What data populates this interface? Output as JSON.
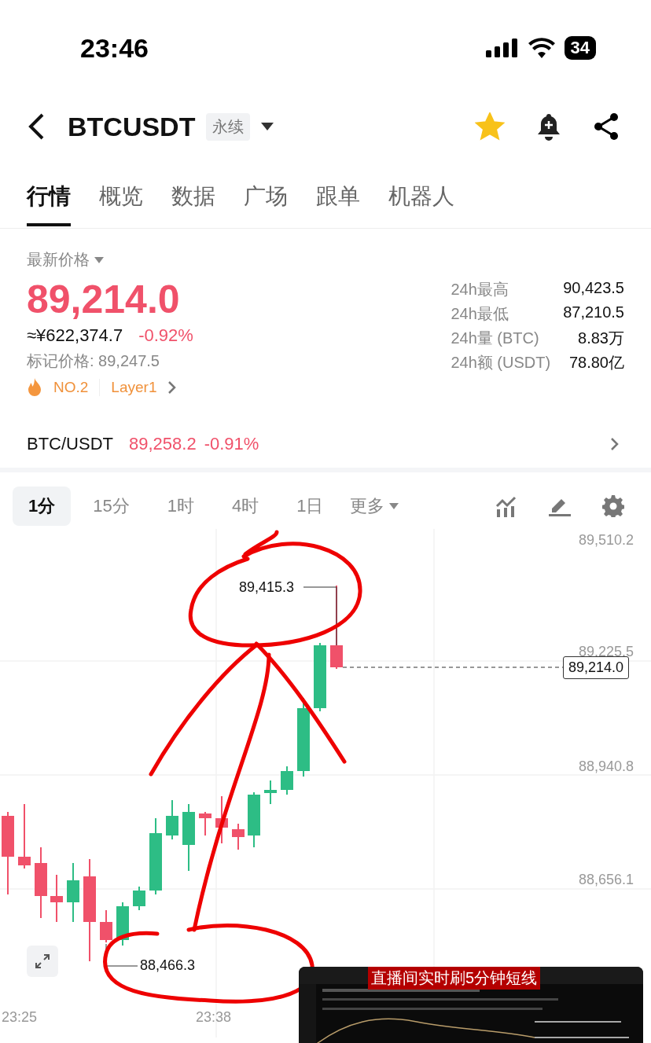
{
  "status_bar": {
    "time": "23:46",
    "battery": "34"
  },
  "header": {
    "symbol": "BTCUSDT",
    "badge": "永续",
    "favorited": true
  },
  "tabs": [
    {
      "label": "行情",
      "selected": true
    },
    {
      "label": "概览",
      "selected": false
    },
    {
      "label": "数据",
      "selected": false
    },
    {
      "label": "广场",
      "selected": false
    },
    {
      "label": "跟单",
      "selected": false
    },
    {
      "label": "机器人",
      "selected": false
    }
  ],
  "price": {
    "label": "最新价格",
    "last": "89,214.0",
    "cny": "≈¥622,374.7",
    "change": "-0.92%",
    "mark_price": "标记价格: 89,247.5",
    "rank": "NO.2",
    "sector": "Layer1"
  },
  "stats": [
    {
      "label": "24h最高",
      "value": "90,423.5"
    },
    {
      "label": "24h最低",
      "value": "87,210.5"
    },
    {
      "label": "24h量 (BTC)",
      "value": "8.83万"
    },
    {
      "label": "24h额 (USDT)",
      "value": "78.80亿"
    }
  ],
  "spot": {
    "pair": "BTC/USDT",
    "price": "89,258.2",
    "change": "-0.91%"
  },
  "timeframes": [
    {
      "label": "1分",
      "selected": true
    },
    {
      "label": "15分",
      "selected": false
    },
    {
      "label": "1时",
      "selected": false
    },
    {
      "label": "4时",
      "selected": false
    },
    {
      "label": "1日",
      "selected": false
    }
  ],
  "more": "更多",
  "chart": {
    "price_ticks": [
      "89,510.2",
      "89,225.5",
      "88,940.8",
      "88,656.1"
    ],
    "current_price": "89,214.0",
    "high_label": "89,415.3",
    "low_label": "88,466.3",
    "time_labels": [
      "23:25",
      "23:38"
    ]
  },
  "overlay": {
    "caption": "直播间实时刷5分钟短线"
  }
}
